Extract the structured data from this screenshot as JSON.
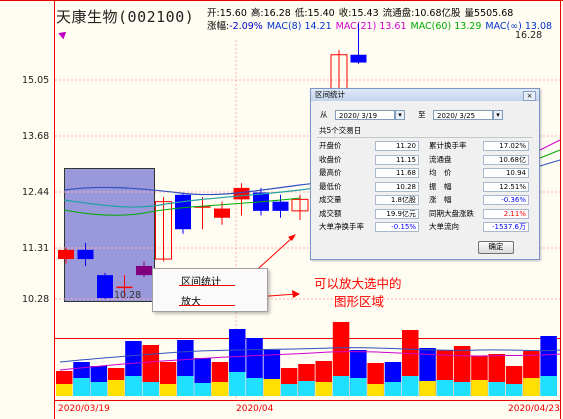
{
  "stock": {
    "name": "天康生物",
    "code": "(002100)"
  },
  "quote_row1": [
    {
      "label": "开:",
      "value": "15.60"
    },
    {
      "label": "高:",
      "value": "16.28"
    },
    {
      "label": "低:",
      "value": "15.40"
    },
    {
      "label": "收:",
      "value": "15.43"
    },
    {
      "label": "流通盘:",
      "value": "10.68亿股"
    },
    {
      "label": "量",
      "value": "5505.68"
    }
  ],
  "quote_row2": {
    "change_label": "涨幅:",
    "change_value": "-2.09%",
    "ma": [
      {
        "label": "MAC(8)",
        "value": "14.21",
        "color": "#0033cc"
      },
      {
        "label": "MAC(21)",
        "value": "13.61",
        "color": "#cc00cc"
      },
      {
        "label": "MAC(60)",
        "value": "13.29",
        "color": "#00aa00"
      },
      {
        "label": "MAC(∞)",
        "value": "13.08",
        "color": "#0033cc"
      }
    ]
  },
  "price_axis": [
    "15.05",
    "13.68",
    "12.44",
    "11.31",
    "10.28"
  ],
  "high_label": "16.28",
  "low_label": "10.28",
  "date_axis": [
    "2020/03/19",
    "2020/04",
    "2020/04/23"
  ],
  "dialog": {
    "title": "区间统计",
    "close": "×",
    "from_label": "从",
    "from_date": "2020/ 3/19",
    "to_label": "至",
    "to_date": "2020/ 3/25",
    "summary": "共5个交易日",
    "left_rows": [
      {
        "label": "开盘价",
        "value": "11.20",
        "color": "#000000"
      },
      {
        "label": "收盘价",
        "value": "11.15",
        "color": "#000000"
      },
      {
        "label": "最高价",
        "value": "11.68",
        "color": "#000000"
      },
      {
        "label": "最低价",
        "value": "10.28",
        "color": "#000000"
      },
      {
        "label": "成交量",
        "value": "1.8亿股",
        "color": "#000000"
      },
      {
        "label": "成交额",
        "value": "19.9亿元",
        "color": "#000000"
      },
      {
        "label": "大单净换手率",
        "value": "-0.15%",
        "color": "#0000ff"
      }
    ],
    "right_rows": [
      {
        "label": "累计换手率",
        "value": "17.02%",
        "color": "#000000"
      },
      {
        "label": "流通盘",
        "value": "10.68亿",
        "color": "#000000"
      },
      {
        "label": "均　价",
        "value": "10.94",
        "color": "#000000"
      },
      {
        "label": "振　幅",
        "value": "12.51%",
        "color": "#000000"
      },
      {
        "label": "涨　幅",
        "value": "-0.36%",
        "color": "#0000ff"
      },
      {
        "label": "同期大盘涨跌",
        "value": "2.11%",
        "color": "#ff0000"
      },
      {
        "label": "大单流向",
        "value": "-1537.6万",
        "color": "#0000ff"
      }
    ],
    "ok": "确定"
  },
  "context_menu": {
    "item1": "区间统计",
    "item2": "放大"
  },
  "annotation": {
    "line1": "可以放大选中的",
    "line2": "图形区域"
  },
  "candles": [
    {
      "o": 11.35,
      "c": 11.15,
      "h": 11.4,
      "l": 11.05,
      "color": "#ff0000"
    },
    {
      "o": 11.35,
      "c": 11.15,
      "h": 11.5,
      "l": 11.0,
      "color": "#0000ff"
    },
    {
      "o": 10.8,
      "c": 10.3,
      "h": 10.85,
      "l": 10.28,
      "color": "#0000ff"
    },
    {
      "o": 10.55,
      "c": 10.55,
      "h": 10.8,
      "l": 10.3,
      "color": "#ff0000"
    },
    {
      "o": 11.0,
      "c": 10.8,
      "h": 11.1,
      "l": 10.75,
      "color": "#800080"
    },
    {
      "o": 11.15,
      "c": 12.4,
      "h": 12.5,
      "l": 11.1,
      "color": "#ff0000"
    },
    {
      "o": 12.55,
      "c": 11.8,
      "h": 12.6,
      "l": 11.7,
      "color": "#0000ff"
    },
    {
      "o": 12.3,
      "c": 12.3,
      "h": 12.5,
      "l": 11.8,
      "color": "#ff0000"
    },
    {
      "o": 12.25,
      "c": 12.05,
      "h": 12.4,
      "l": 11.9,
      "color": "#ff0000"
    },
    {
      "o": 12.7,
      "c": 12.45,
      "h": 12.8,
      "l": 12.1,
      "color": "#ff0000"
    },
    {
      "o": 12.6,
      "c": 12.2,
      "h": 12.7,
      "l": 12.1,
      "color": "#0000ff"
    },
    {
      "o": 12.4,
      "c": 12.2,
      "h": 12.55,
      "l": 12.05,
      "color": "#0000ff"
    },
    {
      "o": 12.2,
      "c": 12.45,
      "h": 12.55,
      "l": 12.0,
      "color": "#ff0000"
    },
    {
      "o": 12.7,
      "c": 13.0,
      "h": 13.1,
      "l": 12.6,
      "color": "#ff0000"
    },
    {
      "o": 14.0,
      "c": 15.6,
      "h": 15.7,
      "l": 13.9,
      "color": "#ff0000"
    },
    {
      "o": 15.6,
      "c": 15.43,
      "h": 16.28,
      "l": 15.4,
      "color": "#0000ff"
    }
  ],
  "volumes": [
    {
      "v": 25,
      "y": 12,
      "color": "#ff0000"
    },
    {
      "v": 34,
      "y": 18,
      "color": "#0000ff"
    },
    {
      "v": 30,
      "y": 14,
      "color": "#0000ff"
    },
    {
      "v": 28,
      "y": 16,
      "color": "#ff0000"
    },
    {
      "v": 55,
      "y": 20,
      "color": "#0000ff"
    },
    {
      "v": 51,
      "y": 14,
      "color": "#ff0000"
    },
    {
      "v": 34,
      "y": 12,
      "color": "#ff0000"
    },
    {
      "v": 56,
      "y": 20,
      "color": "#0000ff"
    },
    {
      "v": 38,
      "y": 13,
      "color": "#0000ff"
    },
    {
      "v": 34,
      "y": 14,
      "color": "#ff0000"
    },
    {
      "v": 67,
      "y": 24,
      "color": "#0000ff"
    },
    {
      "v": 58,
      "y": 18,
      "color": "#0000ff"
    },
    {
      "v": 46,
      "y": 17,
      "color": "#0000ff"
    },
    {
      "v": 28,
      "y": 12,
      "color": "#ff0000"
    },
    {
      "v": 32,
      "y": 15,
      "color": "#ff0000"
    },
    {
      "v": 35,
      "y": 14,
      "color": "#ff0000"
    },
    {
      "v": 74,
      "y": 20,
      "color": "#ff0000"
    },
    {
      "v": 46,
      "y": 18,
      "color": "#0000ff"
    },
    {
      "v": 33,
      "y": 12,
      "color": "#ff0000"
    },
    {
      "v": 34,
      "y": 14,
      "color": "#0000ff"
    },
    {
      "v": 66,
      "y": 20,
      "color": "#ff0000"
    },
    {
      "v": 48,
      "y": 15,
      "color": "#0000ff"
    },
    {
      "v": 46,
      "y": 16,
      "color": "#ff0000"
    },
    {
      "v": 50,
      "y": 14,
      "color": "#ff0000"
    },
    {
      "v": 40,
      "y": 16,
      "color": "#ff0000"
    },
    {
      "v": 42,
      "y": 14,
      "color": "#ff0000"
    },
    {
      "v": 30,
      "y": 12,
      "color": "#ff0000"
    },
    {
      "v": 45,
      "y": 18,
      "color": "#ff0000"
    },
    {
      "v": 60,
      "y": 20,
      "color": "#0000ff"
    }
  ]
}
